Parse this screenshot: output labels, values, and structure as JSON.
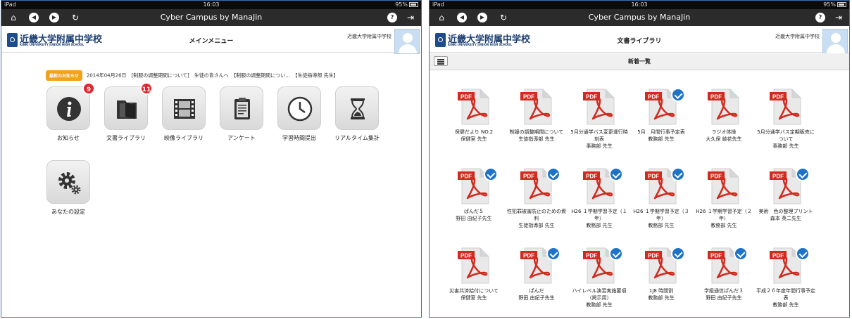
{
  "colors": {
    "accent": "#1e73c8",
    "badge": "#e2242c",
    "news_badge": "#f0a31b",
    "navbar": "#2b2b2b",
    "logo": "#1d3e73"
  },
  "status": {
    "device": "iPad",
    "time": "16:03",
    "battery": "95%"
  },
  "navbar": {
    "title": "Cyber Campus by ManaJin",
    "icons": [
      "home-icon",
      "back-icon",
      "forward-icon",
      "reload-icon",
      "help-icon",
      "logout-icon"
    ]
  },
  "header": {
    "logo_jp": "近畿大学附属中学校",
    "logo_en": "KINKI UNIVERSITY JUNIOR HIGH SCHOOL",
    "school": "近畿大学附属中学校"
  },
  "main_menu": {
    "title": "メインメニュー",
    "news": {
      "badge": "最新のお知らせ",
      "text": "2014年04月26日　[制服の調整期間について]　生徒の皆さんへ　【制服の調整期間につい...　【生徒指導部 先生】"
    },
    "tiles": [
      {
        "label": "お知らせ",
        "icon": "info-icon",
        "badge": "9"
      },
      {
        "label": "文書ライブラリ",
        "icon": "folder-icon",
        "badge": "11"
      },
      {
        "label": "映像ライブラリ",
        "icon": "film-icon",
        "badge": ""
      },
      {
        "label": "アンケート",
        "icon": "clipboard-icon",
        "badge": ""
      },
      {
        "label": "学習時間提出",
        "icon": "clock-icon",
        "badge": ""
      },
      {
        "label": "リアルタイム集計",
        "icon": "hourglass-icon",
        "badge": ""
      },
      {
        "label": "あなたの設定",
        "icon": "gear-icon",
        "badge": ""
      }
    ]
  },
  "library": {
    "title": "文書ライブラリ",
    "subtitle": "新着一覧",
    "file_badge": "PDF",
    "docs": [
      {
        "title": "保健だより NO.2",
        "author": "保健室 先生",
        "checked": false
      },
      {
        "title": "制服の調整期間について",
        "author": "生徒指導部 先生",
        "checked": false
      },
      {
        "title": "5月分通学バス変更運行時刻表",
        "author": "事務部 先生",
        "checked": false
      },
      {
        "title": "5月　月間行事予定表",
        "author": "教務部 先生",
        "checked": true
      },
      {
        "title": "ラジオ体操",
        "author": "大久保 綾花先生",
        "checked": false
      },
      {
        "title": "5月分通学バス定期販売について",
        "author": "事務部 先生",
        "checked": false
      },
      {
        "title": "ぱんだ５",
        "author": "野田 由紀子先生",
        "checked": true
      },
      {
        "title": "性犯罪被害防止のための資料",
        "author": "生徒指導部 先生",
        "checked": true
      },
      {
        "title": "H26 １学期学習予定（１年）",
        "author": "教務部 先生",
        "checked": true
      },
      {
        "title": "H26 １学期学習予定（３年）",
        "author": "教務部 先生",
        "checked": true
      },
      {
        "title": "H26 １学期学習予定（２年）",
        "author": "教務部 先生",
        "checked": false
      },
      {
        "title": "美術　色の整理プリント",
        "author": "森本 英二先生",
        "checked": true
      },
      {
        "title": "災害共済給付について",
        "author": "保健室 先生",
        "checked": false
      },
      {
        "title": "ぱんだ",
        "author": "野田 由紀子先生",
        "checked": true
      },
      {
        "title": "ハイレベル演習実施要項（掲示用）",
        "author": "教務部 先生",
        "checked": true
      },
      {
        "title": "1J8 時間割",
        "author": "教務部 先生",
        "checked": true
      },
      {
        "title": "学級通信ぱんだ３",
        "author": "野田 由紀子先生",
        "checked": true
      },
      {
        "title": "平成２６年度年間行事予定表",
        "author": "教務部 先生",
        "checked": true
      }
    ]
  }
}
